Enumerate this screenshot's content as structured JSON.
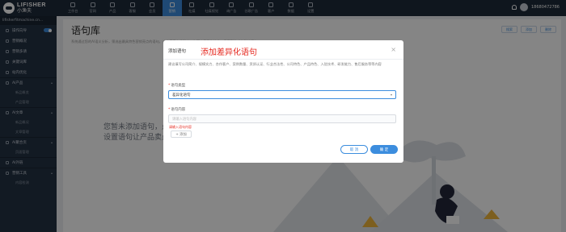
{
  "brand": {
    "name": "LIFISHER",
    "subtitle": "小渔夫"
  },
  "nav": [
    {
      "label": "工作台"
    },
    {
      "label": "官网"
    },
    {
      "label": "产品"
    },
    {
      "label": "客服"
    },
    {
      "label": "会员"
    },
    {
      "label": "营销"
    },
    {
      "label": "社媒"
    },
    {
      "label": "社媒视觉"
    },
    {
      "label": "询广告"
    },
    {
      "label": "谷歌广告"
    },
    {
      "label": "客户"
    },
    {
      "label": "数据"
    },
    {
      "label": "设置"
    }
  ],
  "user": {
    "phone": "18680472786"
  },
  "sidebar": {
    "site": "lifisherfitmachine.cn...",
    "items": [
      {
        "label": "操作向导"
      },
      {
        "label": "营销概况"
      },
      {
        "label": "营销多请"
      },
      {
        "label": "关键词库"
      },
      {
        "label": "站内优化"
      }
    ],
    "groups": [
      {
        "label": "AI产品",
        "subs": [
          "新品概览",
          "产品管理"
        ]
      },
      {
        "label": "AI文章",
        "subs": [
          "新品概况",
          "文章管理"
        ]
      },
      {
        "label": "AI聚合页",
        "subs": [
          "页面管理"
        ]
      },
      {
        "label": "AI外链",
        "subs": []
      },
      {
        "label": "营销工具",
        "subs": [
          "内容检测"
        ]
      }
    ]
  },
  "page": {
    "title": "语句库",
    "description": "系统通过您的AI语义分析，筛选出最具特色营销亮点的语句，让文章更有吸引力。也可查看已生效的，需要删除或修改的语句。",
    "actions": {
      "search": "搜索",
      "add": "添加",
      "delete": "删除"
    },
    "empty_line1": "您暂未添加语句，点",
    "empty_line2": "设置语句让产品卖点"
  },
  "modal": {
    "title": "添加语句",
    "annotation": "添加差异化语句",
    "tip": "建议填写公司简介、规模实力、合作客户、案例数量、资质认证、行业合法性、公司特色、产品特色、入驻技术、研发能力、售后服务等等内容",
    "type_label": "语句类型",
    "type_value": "差异化语句",
    "content_label": "语句内容",
    "content_placeholder": "请输入语句内容",
    "content_error": "请输入语句内容",
    "add_label": "+ 添加",
    "cancel_label": "取 消",
    "ok_label": "确 定"
  },
  "colors": {
    "accent": "#3c8dde",
    "annotation": "#e5281f",
    "sidebar": "#243244",
    "topbar": "#1e2b3a"
  }
}
